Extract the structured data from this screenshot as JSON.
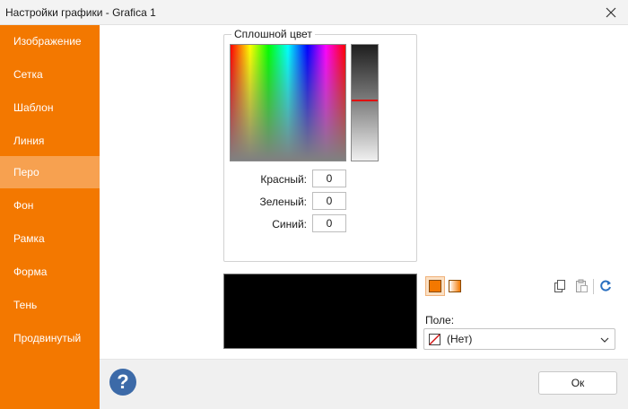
{
  "window": {
    "title": "Настройки графики - Grafica 1"
  },
  "sidebar": {
    "active_index": 4,
    "items": [
      {
        "label": "Изображение"
      },
      {
        "label": "Сетка"
      },
      {
        "label": "Шаблон"
      },
      {
        "label": "Линия"
      },
      {
        "label": "Перо"
      },
      {
        "label": "Фон"
      },
      {
        "label": "Рамка"
      },
      {
        "label": "Форма"
      },
      {
        "label": "Тень"
      },
      {
        "label": "Продвинутый"
      }
    ]
  },
  "solid_color": {
    "group_title": "Сплошной цвет",
    "red_label": "Красный:",
    "red_value": "0",
    "green_label": "Зеленый:",
    "green_value": "0",
    "blue_label": "Синий:",
    "blue_value": "0",
    "preview_color": "#000000"
  },
  "fill_mode": {
    "selected": "solid",
    "options": [
      "solid-fill",
      "gradient-fill"
    ]
  },
  "field": {
    "label": "Поле:",
    "value": "(Нет)"
  },
  "footer": {
    "help_label": "?",
    "ok_label": "Ок"
  },
  "colors": {
    "accent": "#f37800",
    "sidebar_active": "#f7a150",
    "help": "#3c6aa8"
  }
}
